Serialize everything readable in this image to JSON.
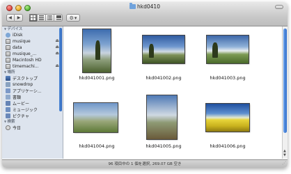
{
  "window": {
    "title": "hkd0410"
  },
  "toolbar": {
    "back_icon": "◀",
    "forward_icon": "▶",
    "views": [
      "icon-view",
      "list-view",
      "column-view",
      "coverflow-view"
    ],
    "action_icon": "gear-icon",
    "action_arrow": "▾"
  },
  "sidebar": {
    "devices_header": "デバイス",
    "devices": [
      {
        "label": "iDisk",
        "icon": "idisk-icon",
        "eject": false
      },
      {
        "label": "musique",
        "icon": "disk-icon",
        "eject": true
      },
      {
        "label": "data",
        "icon": "disk-icon",
        "eject": true
      },
      {
        "label": "musique_...",
        "icon": "disk-icon",
        "eject": true
      },
      {
        "label": "Macintosh HD",
        "icon": "disk-icon",
        "eject": false
      },
      {
        "label": "timemachi...",
        "icon": "disk-icon",
        "eject": true
      }
    ],
    "places_header": "場所",
    "places": [
      {
        "label": "デスクトップ",
        "icon": "desktop-icon"
      },
      {
        "label": "snowdrop",
        "icon": "home-icon"
      },
      {
        "label": "アプリケーシ...",
        "icon": "applications-icon"
      },
      {
        "label": "書類",
        "icon": "documents-icon"
      },
      {
        "label": "ムービー",
        "icon": "movies-icon"
      },
      {
        "label": "ミュージック",
        "icon": "music-icon"
      },
      {
        "label": "ピクチャ",
        "icon": "pictures-icon"
      }
    ],
    "search_header": "検索",
    "search": [
      {
        "label": "今日",
        "icon": "clock-icon"
      }
    ],
    "eject_glyph": "⏏"
  },
  "files": [
    {
      "name": "hkd041001.png"
    },
    {
      "name": "hkd041002.png"
    },
    {
      "name": "hkd041003.png"
    },
    {
      "name": "hkd041004.png"
    },
    {
      "name": "hkd041005.png"
    },
    {
      "name": "hkd041006.png"
    }
  ],
  "status": {
    "text": "96 項目中の 1 個を選択, 269.07 GB 空き"
  }
}
